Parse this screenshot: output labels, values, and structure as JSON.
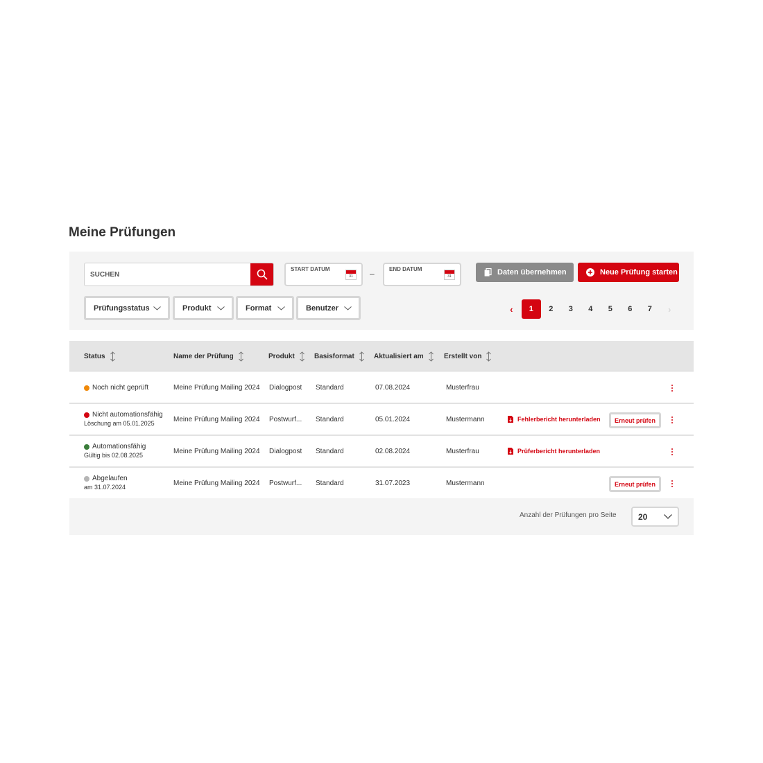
{
  "page": {
    "title": "Meine Prüfungen"
  },
  "filters": {
    "search_placeholder": "SUCHEN",
    "start_date_label": "START DATUM",
    "end_date_label": "END DATUM",
    "date_separator": "–",
    "calendar_day": "31",
    "take_data_label": "Daten übernehmen",
    "new_check_label": "Neue Prüfung starten",
    "dropdowns": [
      "Prüfungsstatus",
      "Produkt",
      "Format",
      "Benutzer"
    ]
  },
  "pagination": {
    "pages": [
      "1",
      "2",
      "3",
      "4",
      "5",
      "6",
      "7"
    ],
    "current": "1",
    "prev": "‹",
    "next": "›"
  },
  "table": {
    "columns": [
      "Status",
      "Name der Prüfung",
      "Produkt",
      "Basisformat",
      "Aktualisiert am",
      "Erstellt von"
    ],
    "rows": [
      {
        "status": "Noch nicht geprüft",
        "status_color": "#f0890a",
        "status_sub": "",
        "name": "Meine Prüfung Mailing 2024",
        "product": "Dialogpost",
        "format": "Standard",
        "updated": "07.08.2024",
        "creator": "Musterfrau",
        "link": "",
        "retry": ""
      },
      {
        "status": "Nicht automationsfähig",
        "status_color": "#d40511",
        "status_sub": "Löschung am 05.01.2025",
        "name": "Meine Prüfung Mailing 2024",
        "product": "Postwurf...",
        "format": "Standard",
        "updated": "05.01.2024",
        "creator": "Mustermann",
        "link": "Fehlerbericht herunterladen",
        "retry": "Erneut prüfen"
      },
      {
        "status": "Automationsfähig",
        "status_color": "#3a7d3a",
        "status_sub": "Gültig bis 02.08.2025",
        "name": "Meine Prüfung Mailing 2024",
        "product": "Dialogpost",
        "format": "Standard",
        "updated": "02.08.2024",
        "creator": "Musterfrau",
        "link": "Prüferbericht herunterladen",
        "retry": ""
      },
      {
        "status": "Abgelaufen",
        "status_color": "#b5b5b5",
        "status_sub": "am 31.07.2024",
        "name": "Meine Prüfung Mailing 2024",
        "product": "Postwurf...",
        "format": "Standard",
        "updated": "31.07.2023",
        "creator": "Mustermann",
        "link": "",
        "retry": "Erneut prüfen"
      }
    ]
  },
  "footer": {
    "per_page_label": "Anzahl der Prüfungen pro Seite",
    "per_page_value": "20"
  },
  "colors": {
    "accent": "#d40511",
    "panel": "#f4f4f4",
    "header": "#e5e5e5",
    "button_grey": "#8a8a8a"
  },
  "icons": {
    "search": "search-icon",
    "calendar": "calendar-icon",
    "copy": "copy-icon",
    "plus": "plus-circle-icon",
    "chevron": "chevron-down-icon",
    "sort": "sort-icon",
    "pdf": "pdf-icon",
    "more": "kebab-icon"
  }
}
